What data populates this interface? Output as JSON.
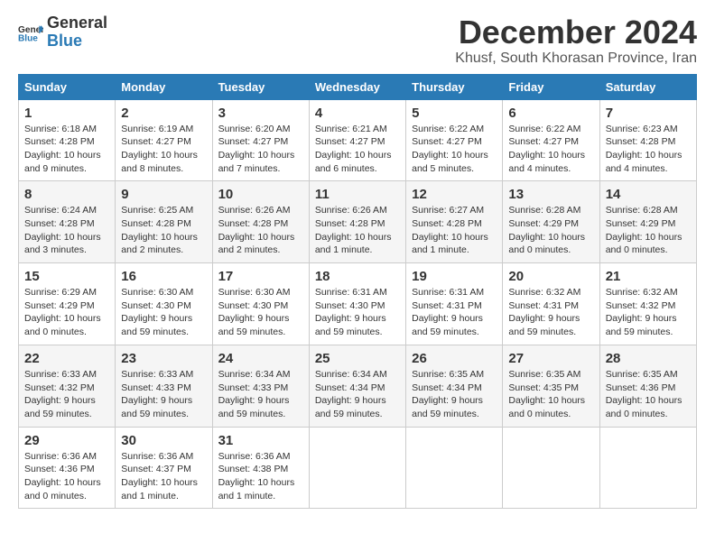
{
  "logo": {
    "general": "General",
    "blue": "Blue"
  },
  "title": "December 2024",
  "subtitle": "Khusf, South Khorasan Province, Iran",
  "days_header": [
    "Sunday",
    "Monday",
    "Tuesday",
    "Wednesday",
    "Thursday",
    "Friday",
    "Saturday"
  ],
  "weeks": [
    [
      {
        "day": "1",
        "sunrise": "6:18 AM",
        "sunset": "4:28 PM",
        "daylight": "10 hours and 9 minutes."
      },
      {
        "day": "2",
        "sunrise": "6:19 AM",
        "sunset": "4:27 PM",
        "daylight": "10 hours and 8 minutes."
      },
      {
        "day": "3",
        "sunrise": "6:20 AM",
        "sunset": "4:27 PM",
        "daylight": "10 hours and 7 minutes."
      },
      {
        "day": "4",
        "sunrise": "6:21 AM",
        "sunset": "4:27 PM",
        "daylight": "10 hours and 6 minutes."
      },
      {
        "day": "5",
        "sunrise": "6:22 AM",
        "sunset": "4:27 PM",
        "daylight": "10 hours and 5 minutes."
      },
      {
        "day": "6",
        "sunrise": "6:22 AM",
        "sunset": "4:27 PM",
        "daylight": "10 hours and 4 minutes."
      },
      {
        "day": "7",
        "sunrise": "6:23 AM",
        "sunset": "4:28 PM",
        "daylight": "10 hours and 4 minutes."
      }
    ],
    [
      {
        "day": "8",
        "sunrise": "6:24 AM",
        "sunset": "4:28 PM",
        "daylight": "10 hours and 3 minutes."
      },
      {
        "day": "9",
        "sunrise": "6:25 AM",
        "sunset": "4:28 PM",
        "daylight": "10 hours and 2 minutes."
      },
      {
        "day": "10",
        "sunrise": "6:26 AM",
        "sunset": "4:28 PM",
        "daylight": "10 hours and 2 minutes."
      },
      {
        "day": "11",
        "sunrise": "6:26 AM",
        "sunset": "4:28 PM",
        "daylight": "10 hours and 1 minute."
      },
      {
        "day": "12",
        "sunrise": "6:27 AM",
        "sunset": "4:28 PM",
        "daylight": "10 hours and 1 minute."
      },
      {
        "day": "13",
        "sunrise": "6:28 AM",
        "sunset": "4:29 PM",
        "daylight": "10 hours and 0 minutes."
      },
      {
        "day": "14",
        "sunrise": "6:28 AM",
        "sunset": "4:29 PM",
        "daylight": "10 hours and 0 minutes."
      }
    ],
    [
      {
        "day": "15",
        "sunrise": "6:29 AM",
        "sunset": "4:29 PM",
        "daylight": "10 hours and 0 minutes."
      },
      {
        "day": "16",
        "sunrise": "6:30 AM",
        "sunset": "4:30 PM",
        "daylight": "9 hours and 59 minutes."
      },
      {
        "day": "17",
        "sunrise": "6:30 AM",
        "sunset": "4:30 PM",
        "daylight": "9 hours and 59 minutes."
      },
      {
        "day": "18",
        "sunrise": "6:31 AM",
        "sunset": "4:30 PM",
        "daylight": "9 hours and 59 minutes."
      },
      {
        "day": "19",
        "sunrise": "6:31 AM",
        "sunset": "4:31 PM",
        "daylight": "9 hours and 59 minutes."
      },
      {
        "day": "20",
        "sunrise": "6:32 AM",
        "sunset": "4:31 PM",
        "daylight": "9 hours and 59 minutes."
      },
      {
        "day": "21",
        "sunrise": "6:32 AM",
        "sunset": "4:32 PM",
        "daylight": "9 hours and 59 minutes."
      }
    ],
    [
      {
        "day": "22",
        "sunrise": "6:33 AM",
        "sunset": "4:32 PM",
        "daylight": "9 hours and 59 minutes."
      },
      {
        "day": "23",
        "sunrise": "6:33 AM",
        "sunset": "4:33 PM",
        "daylight": "9 hours and 59 minutes."
      },
      {
        "day": "24",
        "sunrise": "6:34 AM",
        "sunset": "4:33 PM",
        "daylight": "9 hours and 59 minutes."
      },
      {
        "day": "25",
        "sunrise": "6:34 AM",
        "sunset": "4:34 PM",
        "daylight": "9 hours and 59 minutes."
      },
      {
        "day": "26",
        "sunrise": "6:35 AM",
        "sunset": "4:34 PM",
        "daylight": "9 hours and 59 minutes."
      },
      {
        "day": "27",
        "sunrise": "6:35 AM",
        "sunset": "4:35 PM",
        "daylight": "10 hours and 0 minutes."
      },
      {
        "day": "28",
        "sunrise": "6:35 AM",
        "sunset": "4:36 PM",
        "daylight": "10 hours and 0 minutes."
      }
    ],
    [
      {
        "day": "29",
        "sunrise": "6:36 AM",
        "sunset": "4:36 PM",
        "daylight": "10 hours and 0 minutes."
      },
      {
        "day": "30",
        "sunrise": "6:36 AM",
        "sunset": "4:37 PM",
        "daylight": "10 hours and 1 minute."
      },
      {
        "day": "31",
        "sunrise": "6:36 AM",
        "sunset": "4:38 PM",
        "daylight": "10 hours and 1 minute."
      },
      null,
      null,
      null,
      null
    ]
  ],
  "labels": {
    "sunrise": "Sunrise:",
    "sunset": "Sunset:",
    "daylight": "Daylight:"
  }
}
